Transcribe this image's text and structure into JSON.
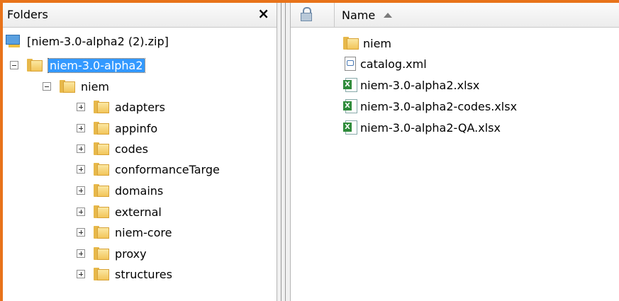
{
  "folders_pane": {
    "title": "Folders",
    "close_glyph": "×",
    "tree": {
      "zip": {
        "label": "[niem-3.0-alpha2 (2).zip]",
        "icon": "zip-archive-icon"
      },
      "root": {
        "label": "niem-3.0-alpha2",
        "expanded": true,
        "selected": true
      },
      "niem": {
        "label": "niem",
        "expanded": true
      },
      "children": [
        {
          "label": "adapters"
        },
        {
          "label": "appinfo"
        },
        {
          "label": "codes"
        },
        {
          "label": "conformanceTarge"
        },
        {
          "label": "domains"
        },
        {
          "label": "external"
        },
        {
          "label": "niem-core"
        },
        {
          "label": "proxy"
        },
        {
          "label": "structures"
        }
      ]
    }
  },
  "file_list": {
    "columns": {
      "lock_icon": "lock-icon",
      "name": "Name",
      "sort": "ascending"
    },
    "items": [
      {
        "name": "niem",
        "type": "folder"
      },
      {
        "name": "catalog.xml",
        "type": "xml"
      },
      {
        "name": "niem-3.0-alpha2.xlsx",
        "type": "xlsx"
      },
      {
        "name": "niem-3.0-alpha2-codes.xlsx",
        "type": "xlsx"
      },
      {
        "name": "niem-3.0-alpha2-QA.xlsx",
        "type": "xlsx"
      }
    ]
  },
  "colors": {
    "frame_accent": "#e8731a",
    "selection": "#3399ff"
  }
}
